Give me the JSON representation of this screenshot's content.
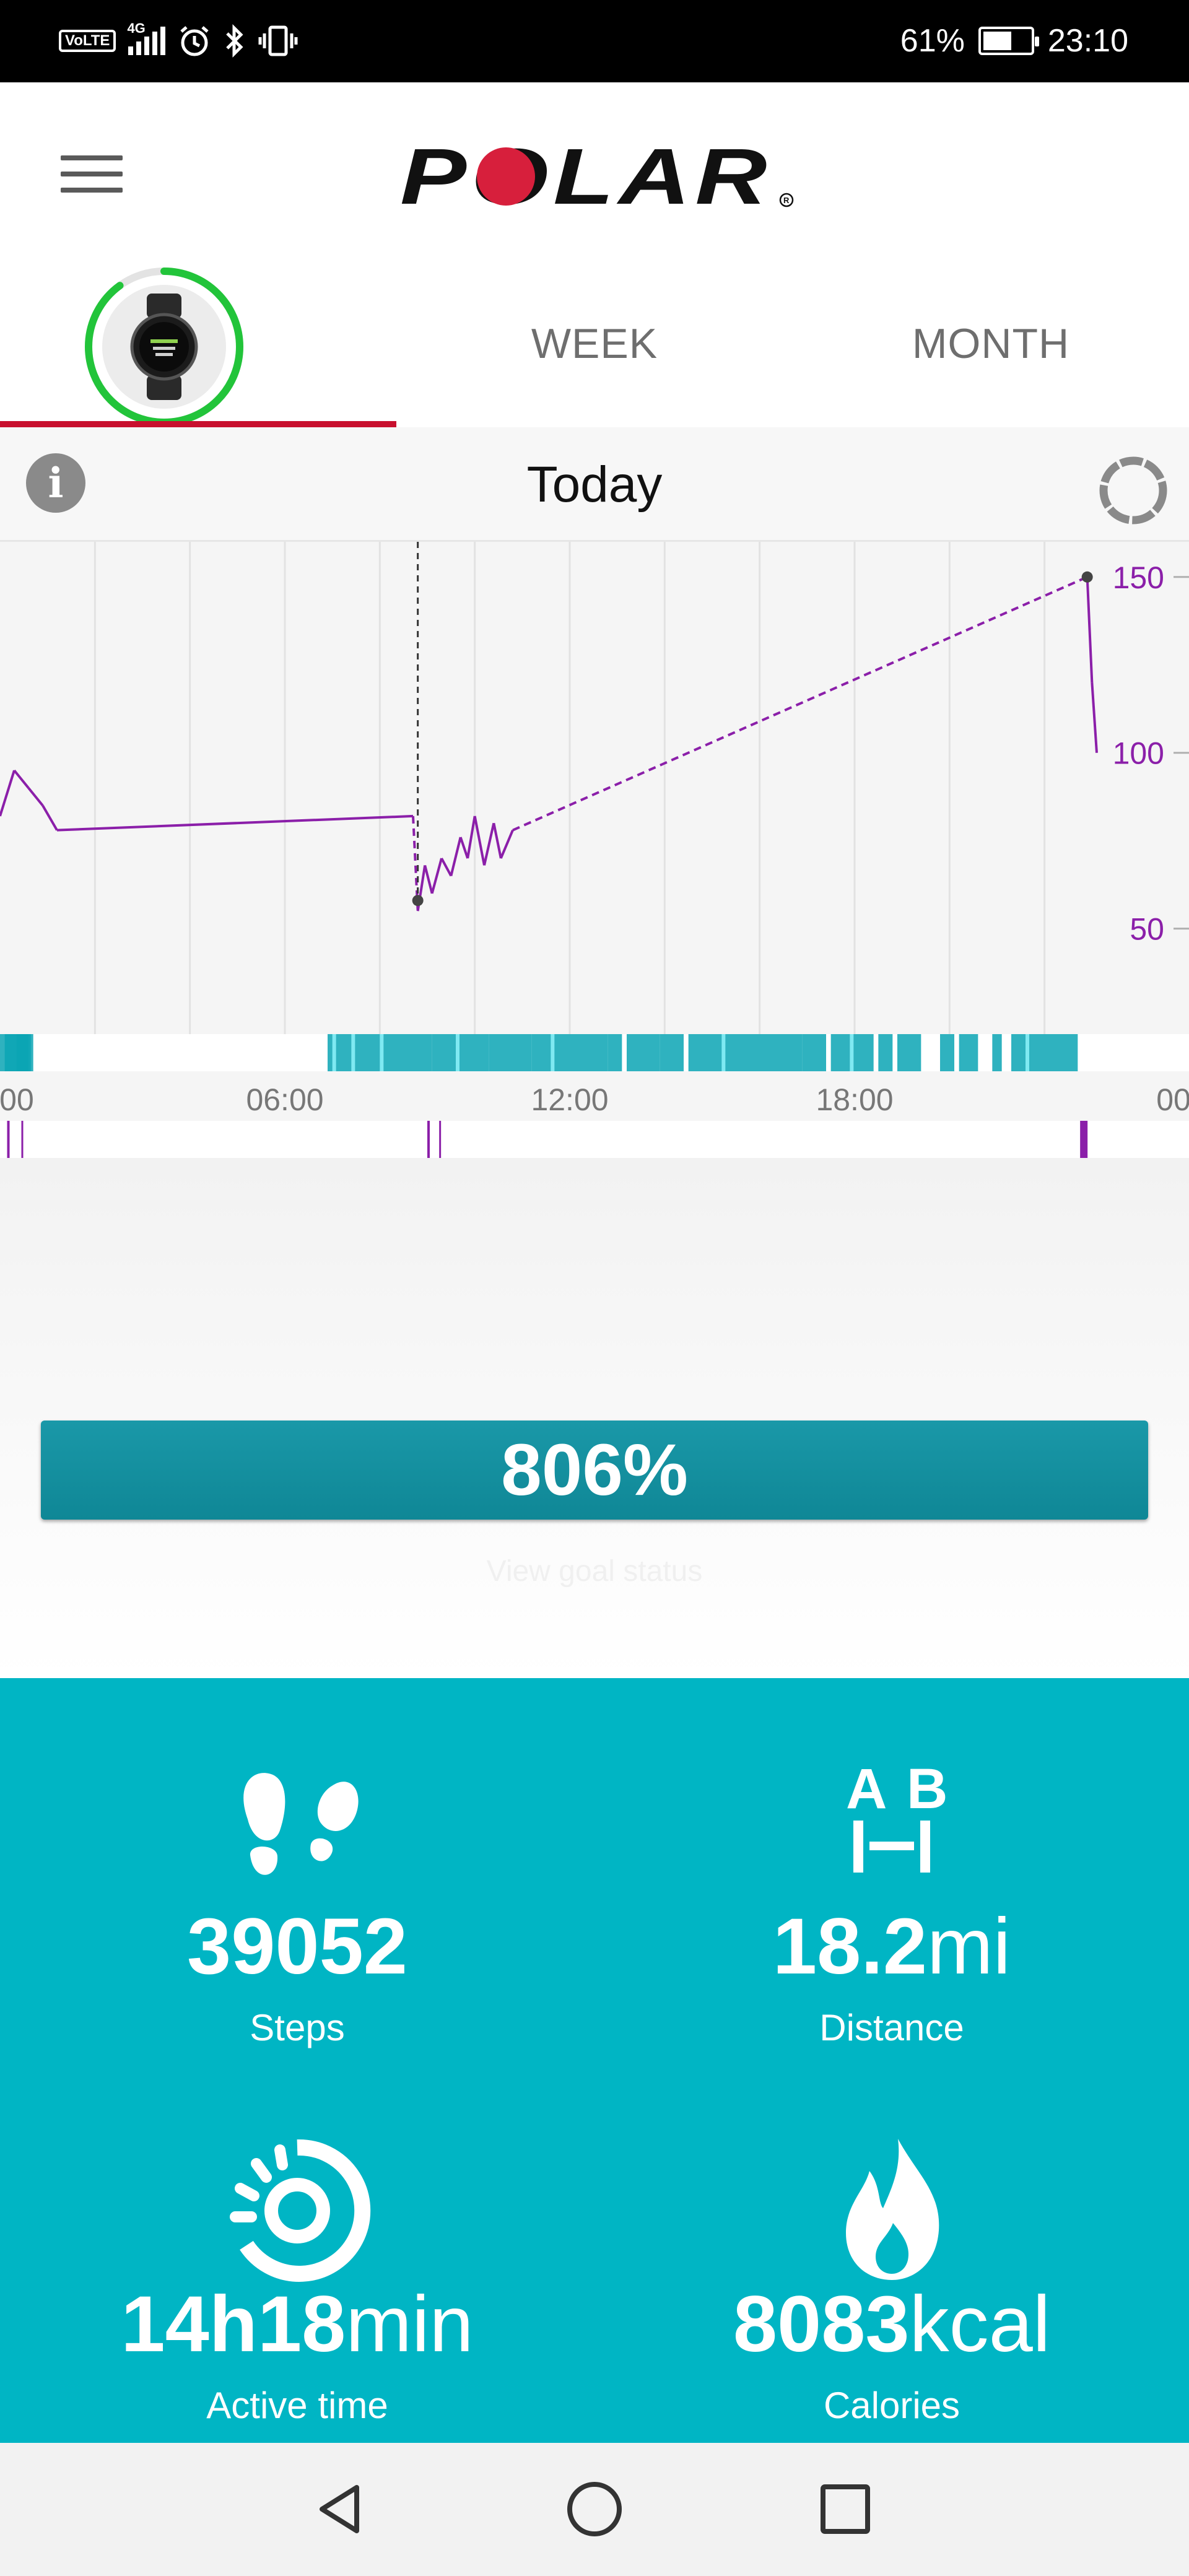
{
  "status_bar": {
    "volte": "VoLTE",
    "network": "4G",
    "battery_percent": "61%",
    "battery_level": 0.61,
    "time": "23:10",
    "icons": [
      "volte-icon",
      "signal-icon",
      "alarm-icon",
      "bluetooth-icon",
      "vibrate-icon",
      "battery-icon"
    ]
  },
  "header": {
    "logo_text": "POLAR",
    "menu_icon": "hamburger-menu-icon"
  },
  "tabs": [
    {
      "label": "",
      "icon": "device-watch-icon",
      "active": true,
      "daily_goal_ring": 0.9
    },
    {
      "label": "WEEK",
      "active": false
    },
    {
      "label": "MONTH",
      "active": false
    }
  ],
  "date_bar": {
    "title": "Today",
    "left_icon": "info-icon",
    "right_icon": "sync-icon"
  },
  "chart_data": {
    "type": "line",
    "series": [
      {
        "color": "#8b1fa9",
        "points": [
          [
            0.0,
            82
          ],
          [
            0.3,
            95
          ],
          [
            0.6,
            90
          ],
          [
            0.9,
            85
          ],
          [
            1.2,
            78
          ],
          [
            8.7,
            82
          ],
          [
            8.8,
            55
          ],
          [
            8.95,
            68
          ],
          [
            9.1,
            60
          ],
          [
            9.3,
            70
          ],
          [
            9.5,
            65
          ],
          [
            9.7,
            76
          ],
          [
            9.85,
            70
          ],
          [
            10.0,
            82
          ],
          [
            10.2,
            68
          ],
          [
            10.4,
            80
          ],
          [
            10.55,
            70
          ],
          [
            10.8,
            78
          ],
          [
            22.9,
            150
          ],
          [
            23.0,
            120
          ],
          [
            23.1,
            100
          ]
        ],
        "gaps_dashed": [
          [
            8.7,
            8.8
          ],
          [
            10.8,
            22.9
          ]
        ]
      }
    ],
    "marker": {
      "x": 8.8,
      "y": 58
    },
    "end_marker": {
      "x": 22.9,
      "y": 150
    },
    "xlim": [
      0,
      24
    ],
    "ylim": [
      20,
      160
    ],
    "yticks": [
      50,
      100,
      150
    ],
    "xtick_labels": [
      ":00",
      "06:00",
      "12:00",
      "18:00",
      "00"
    ],
    "grid": true,
    "activity_band_color": "#0aa5b4",
    "sleep_band_color": "#8b1fa9"
  },
  "progress": {
    "label": "806%",
    "value": 806,
    "fill_fraction": 1.0,
    "link_text": "View goal status"
  },
  "stats": [
    {
      "icon": "steps-icon",
      "value": "39052",
      "unit": "",
      "label": "Steps"
    },
    {
      "icon": "distance-icon",
      "value": "18.2",
      "unit": "mi",
      "label": "Distance",
      "icon_letters": [
        "A",
        "B"
      ]
    },
    {
      "icon": "active-time-icon",
      "value": "14h18",
      "unit": "min",
      "label": "Active time"
    },
    {
      "icon": "calories-icon",
      "value": "8083",
      "unit": "kcal",
      "label": "Calories"
    }
  ],
  "nav_bar": {
    "icons": [
      "back-icon",
      "home-icon",
      "recent-apps-icon"
    ]
  }
}
